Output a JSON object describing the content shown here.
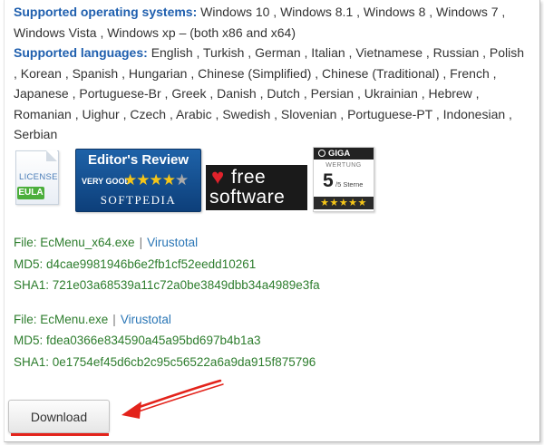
{
  "info": {
    "os_label": "Supported operating systems:",
    "os_value": "Windows 10 , Windows 8.1 , Windows 8 , Windows 7 , Windows Vista , Windows xp – (both x86 and x64)",
    "lang_label": "Supported languages:",
    "lang_value": "English , Turkish , German , Italian , Vietnamese , Russian , Polish , Korean , Spanish , Hungarian , Chinese (Simplified) , Chinese (Traditional) , French , Japanese , Portuguese-Br , Greek , Danish , Dutch , Persian , Ukrainian , Hebrew , Romanian , Uighur , Czech , Arabic , Swedish , Slovenian , Portuguese-PT , Indonesian , Serbian"
  },
  "badges": {
    "license": {
      "line1": "LICENSE",
      "tag": "EULA"
    },
    "softpedia": {
      "title": "Editor's Review",
      "very_good": "VERY GOOD",
      "stars": "★★★★",
      "star_empty": "★",
      "brand": "SOFTPEDIA"
    },
    "ilovefree": {
      "heart": "♥",
      "word1": "free",
      "word2": "software"
    },
    "giga": {
      "logo": "GIGA",
      "wertung": "WERTUNG",
      "rating": "5",
      "sterne": "/5 Sterne",
      "stars": "★★★★★"
    }
  },
  "files": [
    {
      "file": "File: EcMenu_x64.exe",
      "link": "Virustotal",
      "md5": "MD5: d4cae9981946b6e2fb1cf52eedd10261",
      "sha1": "SHA1: 721e03a68539a11c72a0be3849dbb34a4989e3fa"
    },
    {
      "file": "File: EcMenu.exe",
      "link": "Virustotal",
      "md5": "MD5: fdea0366e834590a45a95bd697b4b1a3",
      "sha1": "SHA1: 0e1754ef45d6cb2c95c56522a6a9da915f875796"
    }
  ],
  "download": {
    "label": "Download"
  },
  "colors": {
    "label_blue": "#1f5fae",
    "hash_green": "#2d7d2d",
    "link_blue": "#2a76b6",
    "annotation_red": "#e3231b"
  }
}
